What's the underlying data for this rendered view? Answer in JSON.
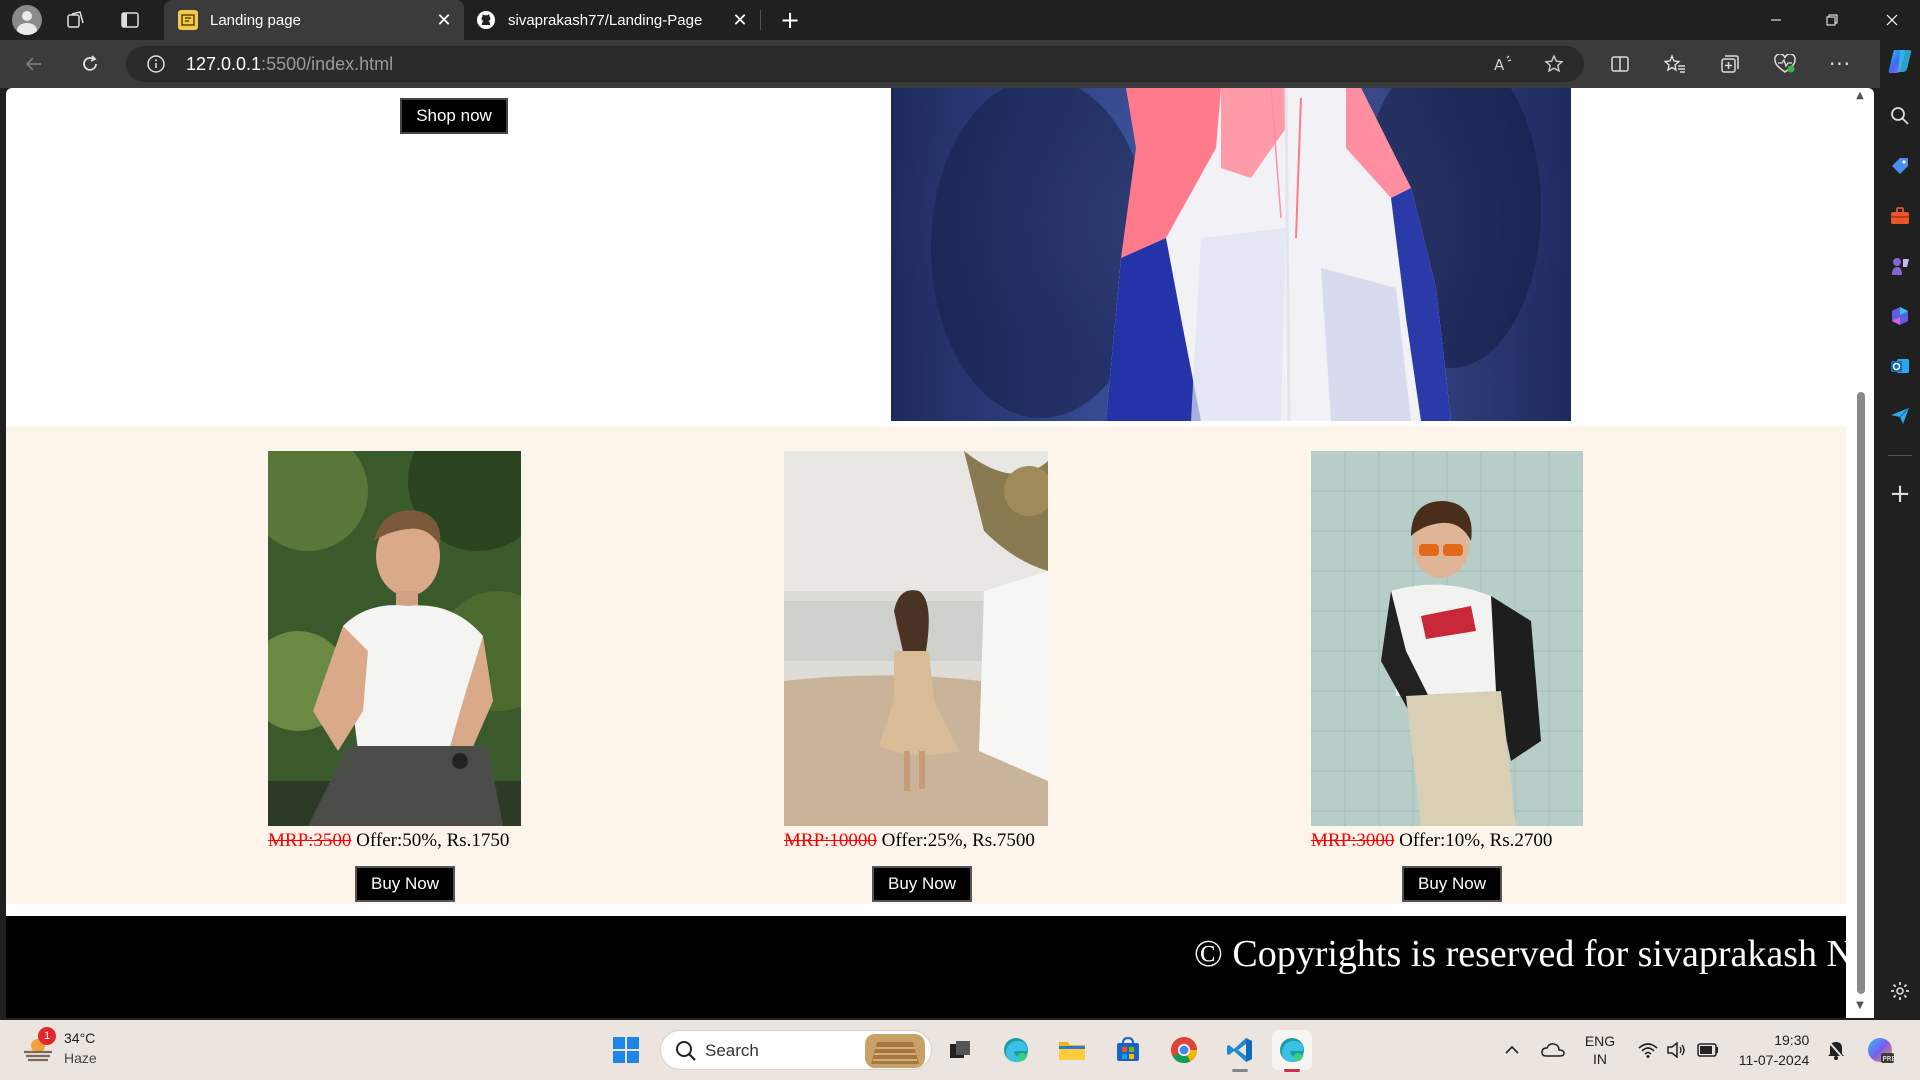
{
  "browser": {
    "tabs": [
      {
        "title": "Landing page",
        "active": true
      },
      {
        "title": "sivaprakash77/Landing-Page",
        "active": false
      }
    ],
    "address": {
      "host": "127.0.0.1",
      "path": ":5500/index.html"
    }
  },
  "page": {
    "hero_button": "Shop now",
    "products": [
      {
        "mrp": "MRP:3500",
        "offer": " Offer:50%, Rs.1750",
        "button": "Buy Now"
      },
      {
        "mrp": "MRP:10000",
        "offer": " Offer:25%, Rs.7500",
        "button": "Buy Now"
      },
      {
        "mrp": "MRP:3000",
        "offer": " Offer:10%, Rs.2700",
        "button": "Buy Now"
      }
    ],
    "footer": "© Copyrights is reserved for sivaprakash N"
  },
  "taskbar": {
    "weather": {
      "temp": "34°C",
      "condition": "Haze",
      "badge": "1"
    },
    "search_placeholder": "Search",
    "lang": {
      "line1": "ENG",
      "line2": "IN"
    },
    "clock": {
      "time": "19:30",
      "date": "11-07-2024"
    }
  },
  "colors": {
    "accent_red": "#ff0000",
    "products_bg": "#fdf5ec",
    "footer_bg": "#000000"
  }
}
